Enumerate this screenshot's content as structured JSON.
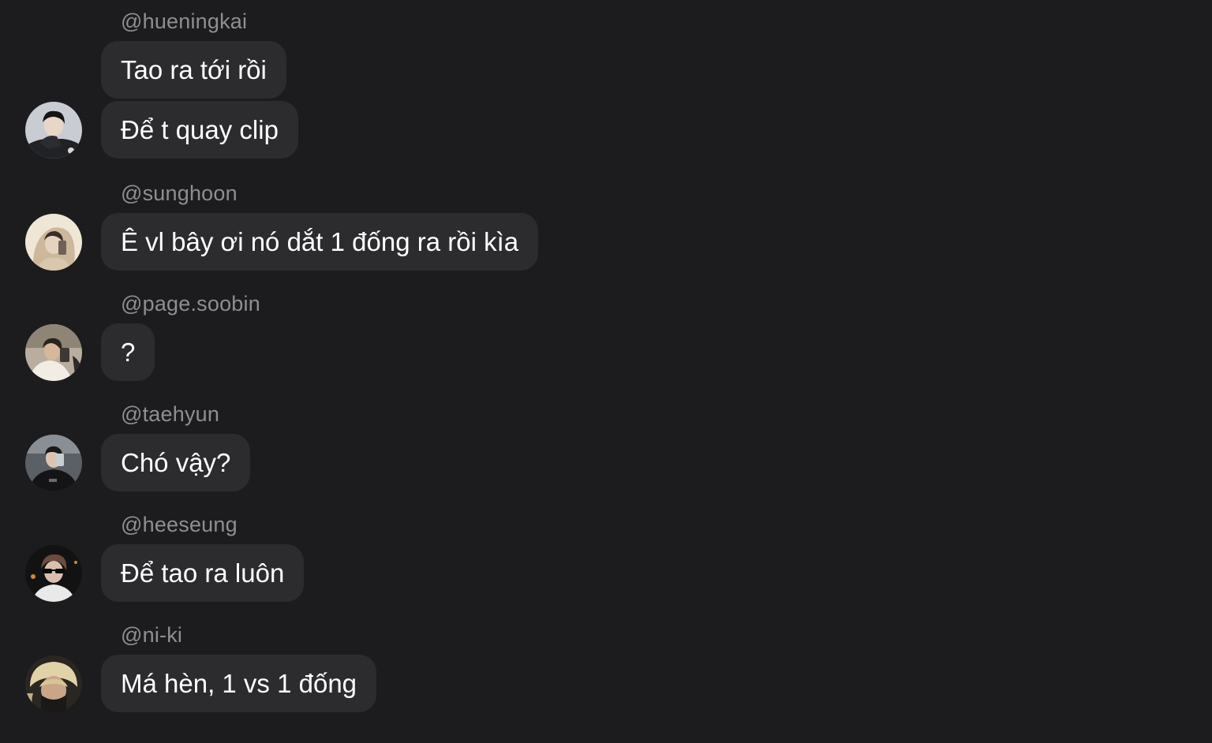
{
  "messages": [
    {
      "username": "@hueningkai",
      "bubbles": [
        "Tao ra tới rồi",
        "Để t quay clip"
      ],
      "avatar_icon": "profile-photo-icon"
    },
    {
      "username": "@sunghoon",
      "bubbles": [
        "Ê vl bây ơi nó dắt 1 đống ra rồi kìa"
      ],
      "avatar_icon": "profile-photo-icon"
    },
    {
      "username": "@page.soobin",
      "bubbles": [
        "?"
      ],
      "avatar_icon": "profile-photo-icon"
    },
    {
      "username": "@taehyun",
      "bubbles": [
        "Chó vậy?"
      ],
      "avatar_icon": "profile-photo-icon"
    },
    {
      "username": "@heeseung",
      "bubbles": [
        "Để tao ra luôn"
      ],
      "avatar_icon": "profile-photo-icon"
    },
    {
      "username": "@ni-ki",
      "bubbles": [
        "Má hèn, 1 vs 1 đống"
      ],
      "avatar_icon": "profile-photo-icon"
    }
  ],
  "colors": {
    "background": "#1c1c1e",
    "bubble": "#2c2c2e",
    "username": "#8e8e93",
    "text": "#ffffff"
  }
}
